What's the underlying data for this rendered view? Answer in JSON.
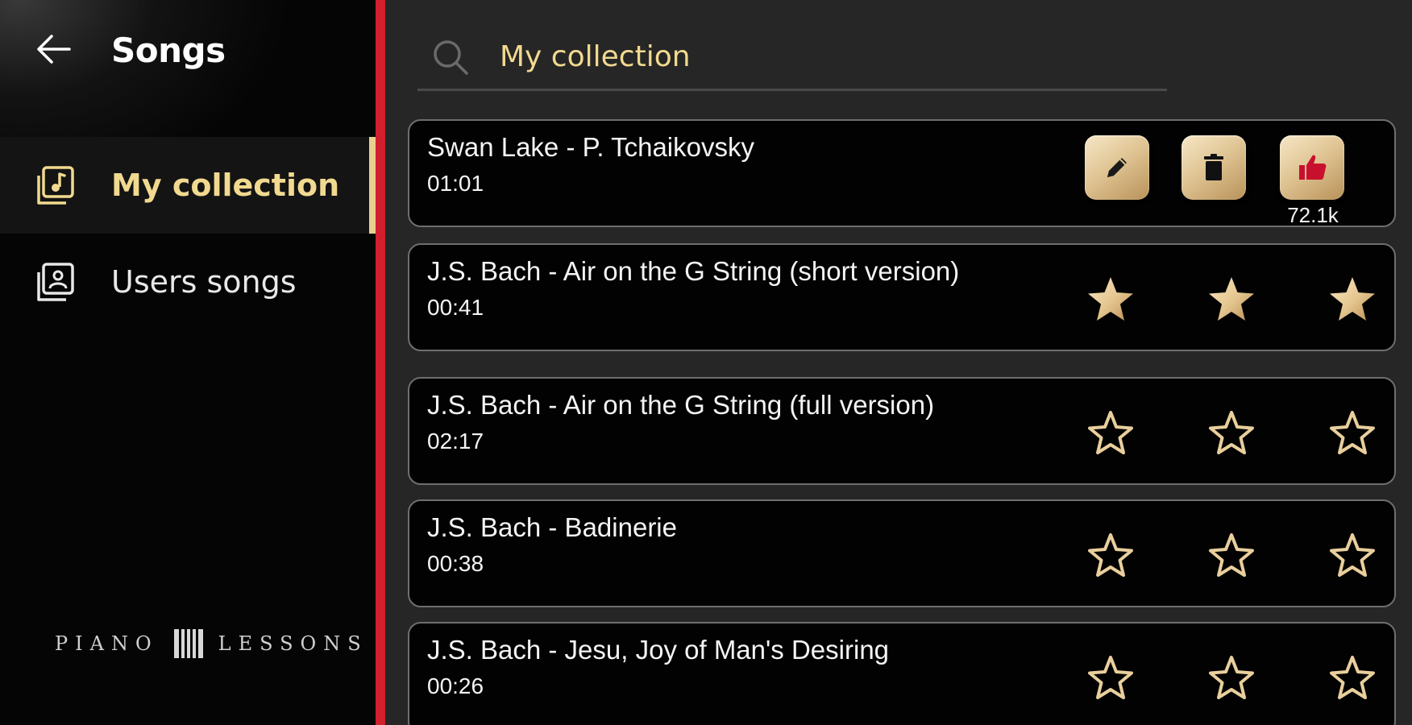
{
  "header": {
    "title": "Songs"
  },
  "sidebar": {
    "items": [
      {
        "label": "My collection",
        "active": true,
        "icon": "music-library-icon"
      },
      {
        "label": "Users songs",
        "active": false,
        "icon": "user-library-icon"
      }
    ],
    "brand": {
      "left": "PIANO",
      "right": "LESSONS"
    }
  },
  "search": {
    "value": "My collection",
    "placeholder": "Search"
  },
  "songs": [
    {
      "title": "Swan Lake - P. Tchaikovsky",
      "duration": "01:01",
      "type": "owned",
      "likes": "72.1k"
    },
    {
      "title": "J.S. Bach - Air on the G String (short version)",
      "duration": "00:41",
      "stars_filled": 3
    },
    {
      "title": "J.S. Bach - Air on the G String (full version)",
      "duration": "02:17",
      "stars_filled": 0
    },
    {
      "title": "J.S. Bach - Badinerie",
      "duration": "00:38",
      "stars_filled": 0
    },
    {
      "title": "J.S. Bach - Jesu, Joy of Man's Desiring",
      "duration": "00:26",
      "stars_filled": 0
    }
  ],
  "colors": {
    "accent_gold": "#f1d98f",
    "divider_red": "#d21f2d",
    "like_red": "#c8102e"
  }
}
